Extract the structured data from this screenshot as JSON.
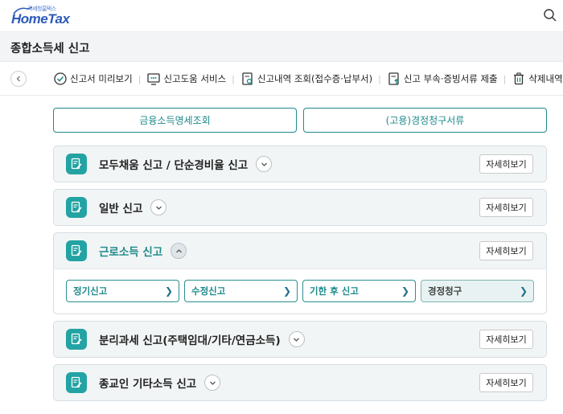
{
  "header": {
    "logo_sub": "국세청홈택스",
    "logo_main": "HomeTax"
  },
  "page": {
    "title": "종합소득세 신고"
  },
  "menu": {
    "items": [
      {
        "label": "신고서 미리보기",
        "icon": "eye-check-icon"
      },
      {
        "label": "신고도움 서비스",
        "icon": "monitor-chat-icon"
      },
      {
        "label": "신고내역 조회(접수증·납부서)",
        "icon": "document-search-icon"
      },
      {
        "label": "신고 부속·증빙서류 제출",
        "icon": "document-upload-icon"
      },
      {
        "label": "삭제내역 조회",
        "icon": "trash-icon"
      }
    ]
  },
  "quick_buttons": [
    {
      "label": "금융소득명세조회"
    },
    {
      "label": "(고용)경정청구서류"
    }
  ],
  "sections": [
    {
      "title": "모두채움 신고 / 단순경비율 신고",
      "detail_label": "자세히보기",
      "expanded": false
    },
    {
      "title": "일반 신고",
      "detail_label": "자세히보기",
      "expanded": false
    },
    {
      "title": "근로소득 신고",
      "detail_label": "자세히보기",
      "expanded": true,
      "sub_buttons": [
        {
          "label": "정기신고"
        },
        {
          "label": "수정신고"
        },
        {
          "label": "기한 후 신고"
        },
        {
          "label": "경정청구"
        }
      ]
    },
    {
      "title": "분리과세 신고(주택임대/기타/연금소득)",
      "detail_label": "자세히보기",
      "expanded": false
    },
    {
      "title": "종교인 기타소득 신고",
      "detail_label": "자세히보기",
      "expanded": false
    }
  ],
  "colors": {
    "accent": "#1f8a8a",
    "icon_bg": "#23a3a3",
    "logo": "#2d5cb8"
  }
}
